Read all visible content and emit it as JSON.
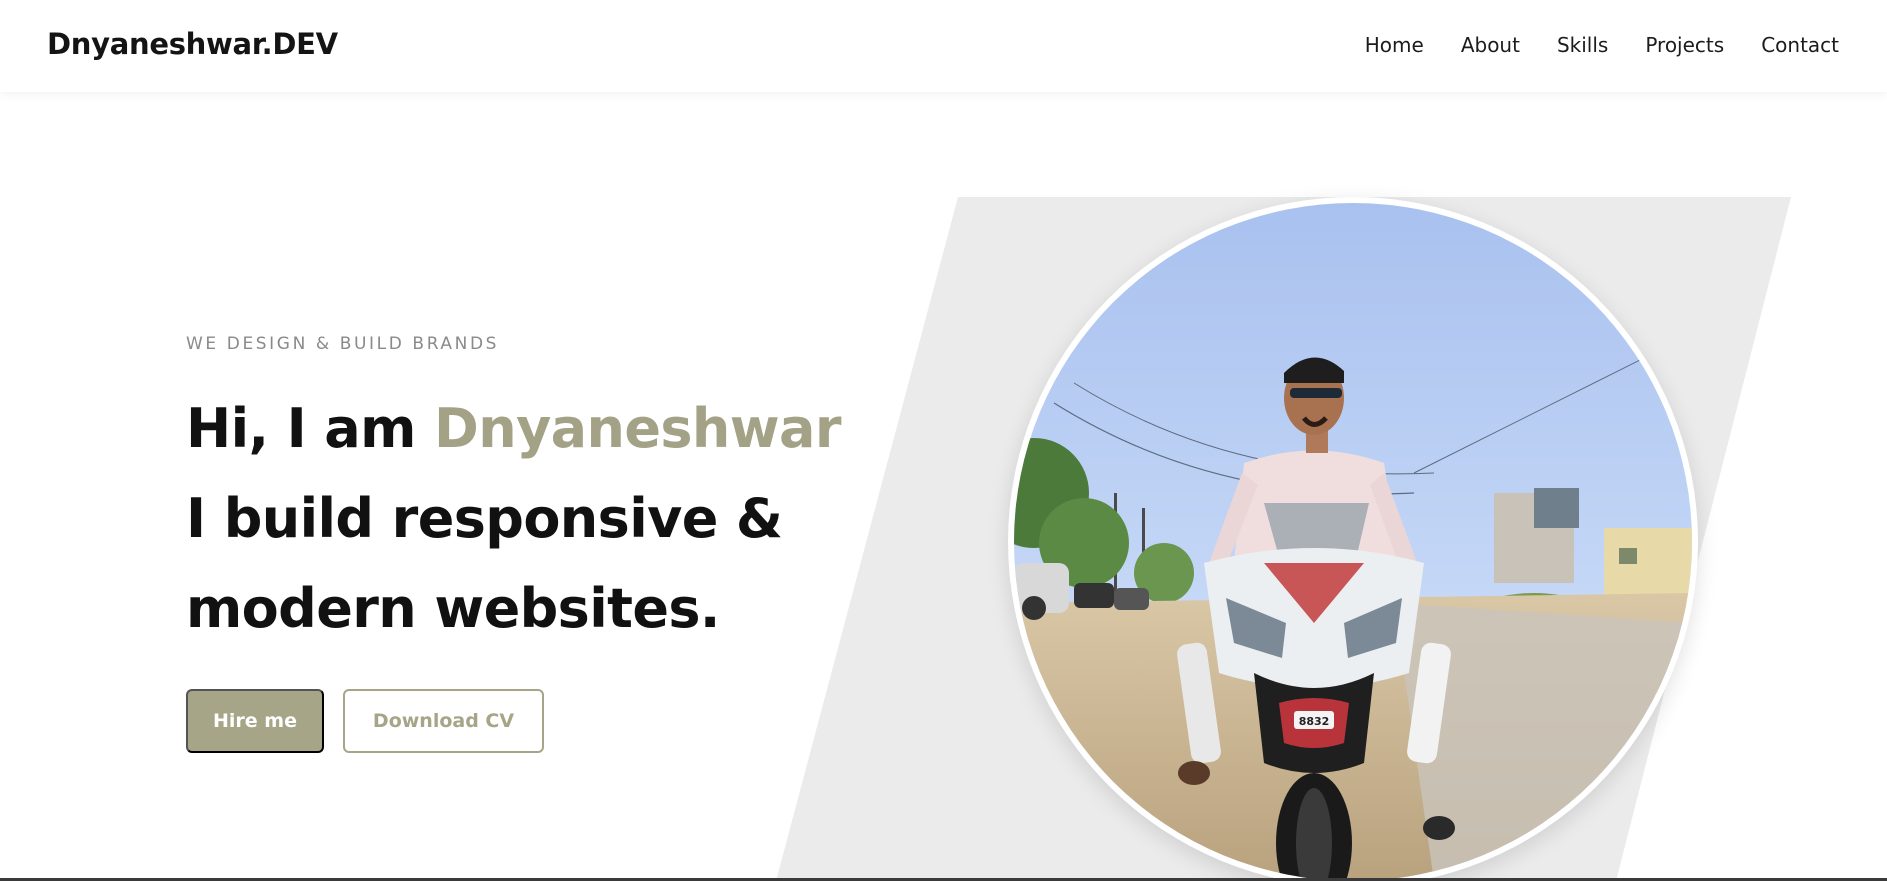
{
  "header": {
    "brand": "Dnyaneshwar.DEV",
    "nav": [
      "Home",
      "About",
      "Skills",
      "Projects",
      "Contact"
    ]
  },
  "hero": {
    "eyebrow": "WE DESIGN & BUILD BRANDS",
    "headline_prefix": "Hi, I am ",
    "headline_name": "Dnyaneshwar",
    "headline_line2": "I build responsive &",
    "headline_line3": "modern websites.",
    "hire_button": "Hire me",
    "cv_button": "Download CV",
    "plate_number": "8832"
  },
  "colors": {
    "accent": "#a6a588",
    "panel": "#ebebeb",
    "text": "#111111"
  }
}
